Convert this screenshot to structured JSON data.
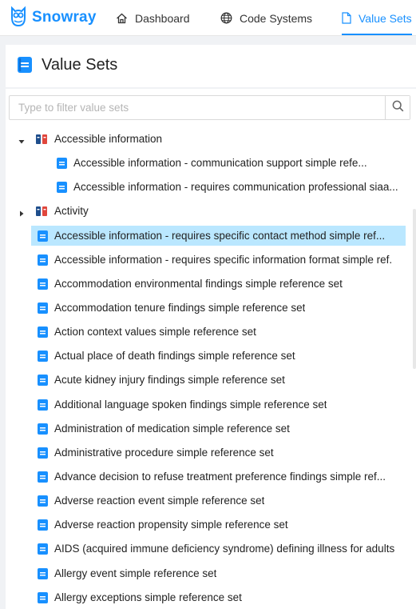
{
  "brand": {
    "name": "Snowray",
    "icon": "owl-logo",
    "color": "#1890ff"
  },
  "nav": {
    "dashboard": "Dashboard",
    "code_systems": "Code Systems",
    "value_sets": "Value Sets"
  },
  "page": {
    "title": "Value Sets"
  },
  "search": {
    "placeholder": "Type to filter value sets"
  },
  "tree": {
    "groups": [
      {
        "label": "Accessible information",
        "expanded": true
      },
      {
        "label": "Activity",
        "expanded": false
      }
    ],
    "children": [
      "Accessible information - communication support simple refe...",
      "Accessible information - requires communication professional siaa..."
    ],
    "items": [
      "Accessible information - requires specific contact method simple ref...",
      "Accessible information - requires specific information format simple ref.",
      "Accommodation environmental findings simple reference set",
      "Accommodation tenure findings simple reference set",
      "Action context values simple reference set",
      "Actual place of death findings simple reference set",
      "Acute kidney injury findings simple reference set",
      "Additional language spoken findings simple reference set",
      "Administration of medication simple reference set",
      "Administrative procedure simple reference set",
      "Advance decision to refuse treatment preference findings simple ref...",
      "Adverse reaction event simple reference set",
      "Adverse reaction propensity simple reference set",
      "AIDS (acquired immune deficiency syndrome) defining illness for adults",
      "Allergy event simple reference set",
      "Allergy exceptions simple reference set"
    ],
    "selected_index": 0
  },
  "colors": {
    "accent": "#1890ff",
    "selected_bg": "#bae7ff",
    "folder_red": "#e0463c",
    "folder_blue": "#1f4e8c"
  }
}
